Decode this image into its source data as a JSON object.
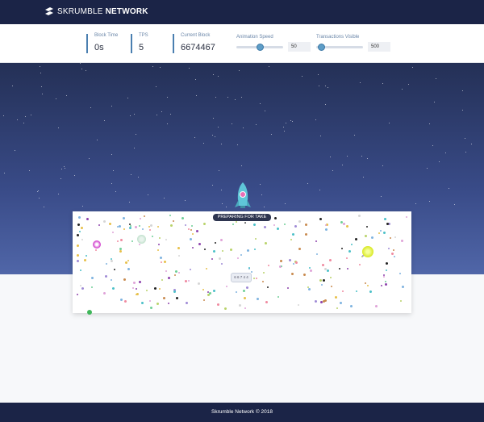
{
  "header": {
    "brand_light": "SKRUMBLE",
    "brand_bold": "NETWORK"
  },
  "stats": [
    {
      "label": "Block Time",
      "value": "0s"
    },
    {
      "label": "TPS",
      "value": "5"
    },
    {
      "label": "Current Block",
      "value": "6674467"
    }
  ],
  "sliders": {
    "animation_speed": {
      "label": "Animation Speed",
      "value": "50",
      "fraction": 0.5
    },
    "transactions_visible": {
      "label": "Transactions Visible",
      "value": "500",
      "fraction": 0.12
    }
  },
  "status": {
    "text": "PREPARING FOR TAKE OFF"
  },
  "block_tip": {
    "text": "6 6 7 4 4"
  },
  "footer": {
    "text": "Skrumble Network © 2018"
  },
  "colors": {
    "nav_bg": "#1b2447",
    "accent": "#4a7fb0",
    "rocket": "#5fc6d8"
  }
}
